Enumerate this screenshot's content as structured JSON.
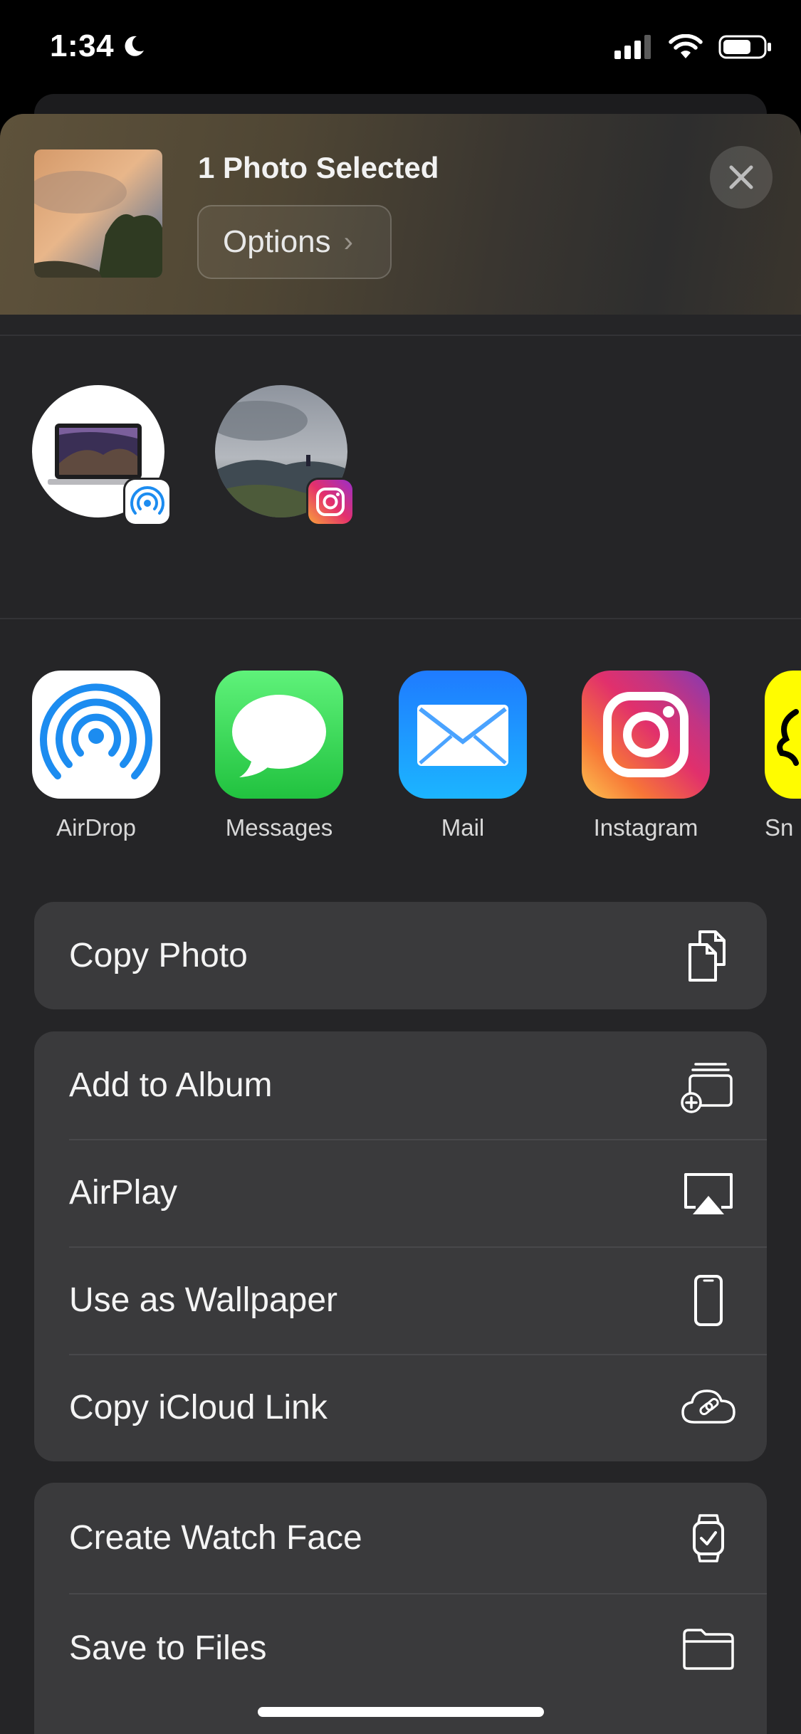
{
  "status_bar": {
    "time": "1:34",
    "moon_icon": "moon-icon",
    "signal_icon": "cellular-signal-icon",
    "wifi_icon": "wifi-icon",
    "battery_icon": "battery-icon"
  },
  "header": {
    "title": "1 Photo Selected",
    "options_label": "Options",
    "options_chevron": "›",
    "close_icon": "close-icon"
  },
  "people": [
    {
      "name": "macbook-airdrop-target",
      "badge": "airdrop-badge-icon"
    },
    {
      "name": "instagram-contact",
      "badge": "instagram-badge-icon"
    }
  ],
  "apps": [
    {
      "label": "AirDrop",
      "icon": "airdrop-icon"
    },
    {
      "label": "Messages",
      "icon": "messages-icon"
    },
    {
      "label": "Mail",
      "icon": "mail-icon"
    },
    {
      "label": "Instagram",
      "icon": "instagram-icon"
    },
    {
      "label": "Sn",
      "icon": "snapchat-icon"
    }
  ],
  "actions": {
    "group1": [
      {
        "label": "Copy Photo",
        "icon": "copy-icon"
      }
    ],
    "group2": [
      {
        "label": "Add to Album",
        "icon": "add-to-album-icon"
      },
      {
        "label": "AirPlay",
        "icon": "airplay-icon"
      },
      {
        "label": "Use as Wallpaper",
        "icon": "iphone-icon"
      },
      {
        "label": "Copy iCloud Link",
        "icon": "icloud-link-icon"
      }
    ],
    "group3": [
      {
        "label": "Create Watch Face",
        "icon": "watch-icon"
      },
      {
        "label": "Save to Files",
        "icon": "folder-icon"
      }
    ]
  },
  "colors": {
    "sheet_bg": "#252527",
    "group_bg": "#3a3a3c",
    "messages_green": "#30d158",
    "mail_blue": "#1a8cff",
    "snapchat_yellow": "#fffc00",
    "airdrop_blue": "#1c8cf0"
  }
}
